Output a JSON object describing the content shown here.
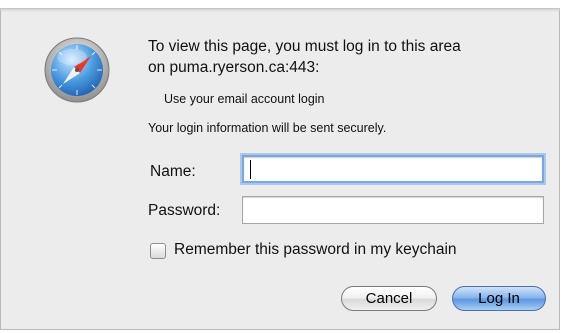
{
  "dialog": {
    "message_line1": "To view this page, you must log in to this area",
    "message_line2": "on puma.ryerson.ca:443:",
    "realm": "Use your email account login",
    "secure_note": "Your login information will be sent securely."
  },
  "form": {
    "name_label": "Name:",
    "name_value": "",
    "password_label": "Password:",
    "password_value": "",
    "remember_label": "Remember this password in my keychain",
    "remember_checked": false
  },
  "buttons": {
    "cancel": "Cancel",
    "login": "Log In"
  },
  "icons": {
    "app_icon": "safari-compass-icon"
  },
  "colors": {
    "focus_ring": "#7da6da",
    "default_button": "#5d95df",
    "dialog_background": "#ececec"
  }
}
